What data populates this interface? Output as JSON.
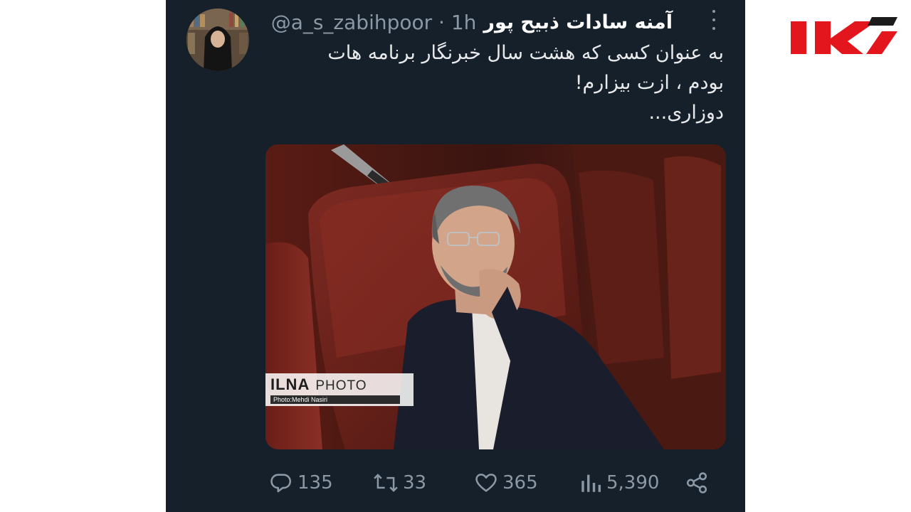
{
  "tweet": {
    "author_name": "آمنه سادات ذبیح پور",
    "handle_time": "@a_s_zabihpoor · 1h",
    "text_lines": [
      "به عنوان کسی که هشت سال خبرنگار برنامه هات",
      "بودم ، ازت بیزارم!",
      "دوزاری..."
    ],
    "media": {
      "watermark_brand": "ILNA",
      "watermark_label": "PHOTO",
      "watermark_credit": "Photo:Mehdi Nasiri"
    },
    "actions": {
      "replies": "135",
      "retweets": "33",
      "likes": "365",
      "views": "5,390"
    }
  },
  "icons": {
    "more": "more-dots-icon",
    "reply": "reply-bubble-icon",
    "retweet": "retweet-icon",
    "like": "heart-icon",
    "views": "views-bars-icon",
    "share": "share-icon",
    "logo": "rokna-logo"
  },
  "colors": {
    "tweet_background": "#15202b",
    "text_primary": "#e7e9ea",
    "text_secondary": "#8b98a5",
    "logo_red": "#e3161e",
    "logo_dark": "#1b1b1b"
  }
}
